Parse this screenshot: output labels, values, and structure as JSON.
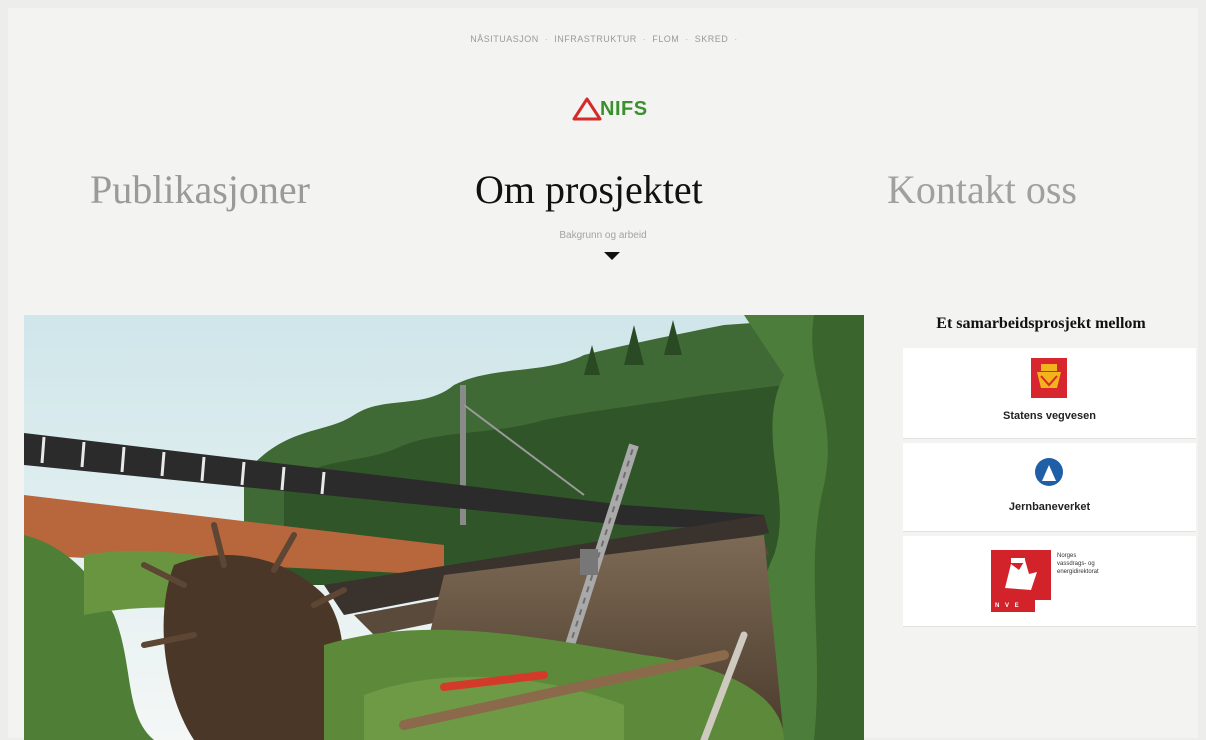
{
  "top_nav": {
    "items": [
      "NÅSITUASJON",
      "INFRASTRUKTUR",
      "FLOM",
      "SKRED"
    ]
  },
  "logo": {
    "text": "NIFS"
  },
  "main_nav": {
    "items": [
      {
        "label": "Publikasjoner",
        "active": false
      },
      {
        "label": "Om prosjektet",
        "active": true
      },
      {
        "label": "Kontakt oss",
        "active": false
      }
    ],
    "subtitle": "Bakgrunn og arbeid"
  },
  "sidebar": {
    "title": "Et samarbeidsprosjekt mellom",
    "partners": [
      {
        "label": "Statens vegvesen",
        "icon": "statens-vegvesen-logo"
      },
      {
        "label": "Jernbaneverket",
        "icon": "jernbaneverket-logo"
      },
      {
        "label": "Norges vassdrags- og energidirektorat",
        "icon": "nve-logo",
        "lines": [
          "Norges",
          "vassdrags- og",
          "energidirektorat"
        ],
        "abbr": "N V E"
      }
    ]
  },
  "colors": {
    "background": "#f3f3f2",
    "logo_red": "#d42a2a",
    "logo_green": "#3c8f2e",
    "nav_active": "#111111",
    "nav_inactive": "#9a9a9a",
    "jernbaneverket_blue": "#1f5fa8",
    "nve_red": "#d2232a"
  }
}
